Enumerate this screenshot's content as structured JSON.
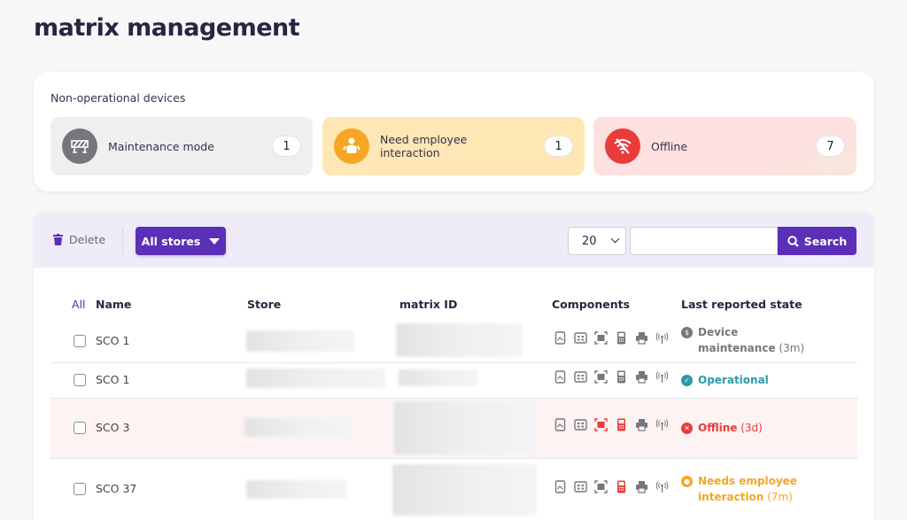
{
  "page": {
    "title": "matrix management"
  },
  "summary": {
    "title": "Non-operational devices",
    "tiles": [
      {
        "label": "Maintenance mode",
        "count": "1",
        "icon": "barrier-icon",
        "color": "#77767c"
      },
      {
        "label": "Need employee interaction",
        "count": "1",
        "icon": "person-icon",
        "color": "#f6a623"
      },
      {
        "label": "Offline",
        "count": "7",
        "icon": "wifi-off-icon",
        "color": "#ea3b3b"
      }
    ]
  },
  "toolbar": {
    "delete_label": "Delete",
    "stores_label": "All stores",
    "page_size": "20",
    "search_value": "",
    "search_label": "Search",
    "accent": "#5b2fb8"
  },
  "table": {
    "headers": {
      "all": "All",
      "name": "Name",
      "store": "Store",
      "matrix_id": "matrix ID",
      "components": "Components",
      "state": "Last reported state"
    },
    "rows": [
      {
        "name": "SCO 1",
        "state": "Device maintenance",
        "state_detail": "(3m)",
        "state_color": "#77767c",
        "scanner_color": "#77767c",
        "payment_color": "#77767c"
      },
      {
        "name": "SCO 1",
        "state": "Operational",
        "state_detail": "",
        "state_color": "#2a9aa8",
        "scanner_color": "#77767c",
        "payment_color": "#77767c"
      },
      {
        "name": "SCO 3",
        "state": "Offline",
        "state_detail": "(3d)",
        "state_color": "#ea3b3b",
        "scanner_color": "#ea3b3b",
        "payment_color": "#ea3b3b"
      },
      {
        "name": "SCO 37",
        "state": "Needs employee interaction",
        "state_detail": "(7m)",
        "state_color": "#f6a623",
        "scanner_color": "#77767c",
        "payment_color": "#ea3b3b"
      }
    ]
  }
}
